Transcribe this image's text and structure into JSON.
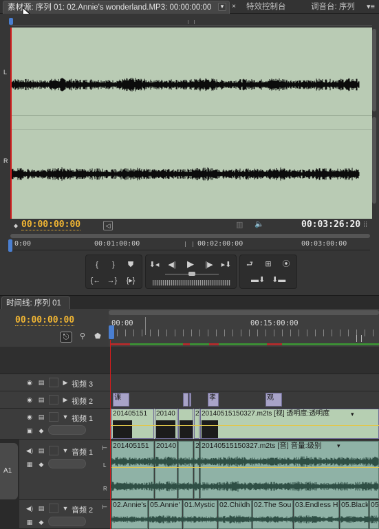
{
  "tabs": {
    "source": "素材源: 序列 01: 02.Annie's wonderland.MP3: 00:00:00:00",
    "effects": "特效控制台",
    "mixer": "调音台: 序列"
  },
  "monitor": {
    "channel_left": "L",
    "channel_right": "R",
    "current_time": "00:00:00:00",
    "duration": "00:03:26:20",
    "ruler": [
      "0:00",
      "00:01:00:00",
      "00:02:00:00",
      "00:03:00:00"
    ],
    "ruler_position": 0.0
  },
  "timeline": {
    "tab_title": "时间线: 序列 01",
    "current_time": "00:00:00:00",
    "ruler": [
      "00:00",
      "00:15:00:00"
    ],
    "target_label": "A1",
    "tracks": {
      "v3": "视频 3",
      "v2": "视频 2",
      "v1": "视频 1",
      "a1": "音频 1",
      "a2": "音频 2"
    },
    "v2_clips": [
      "课",
      "",
      "",
      "孝",
      "观"
    ],
    "v1_clips": [
      "201405151",
      "20140",
      "",
      "2",
      "20140515150327.m2ts [视] 透明度:透明度"
    ],
    "a1_clips": [
      "201405151",
      "20140",
      "",
      "2",
      "20140515150327.m2ts [音] 音量:级别"
    ],
    "a2_clips": [
      "02.Annie's",
      "05.Annie'",
      "01.Mystic",
      "02.Childh",
      "02.The Sou",
      "03.Endless H",
      "05.Black",
      "05"
    ]
  },
  "colors": {
    "wave_bg": "#b9cbb4",
    "timecode": "#f0b533",
    "playhead": "#d41c1c",
    "video_clip": "#a8a3c8",
    "audio_clip": "#8fb2a6"
  }
}
